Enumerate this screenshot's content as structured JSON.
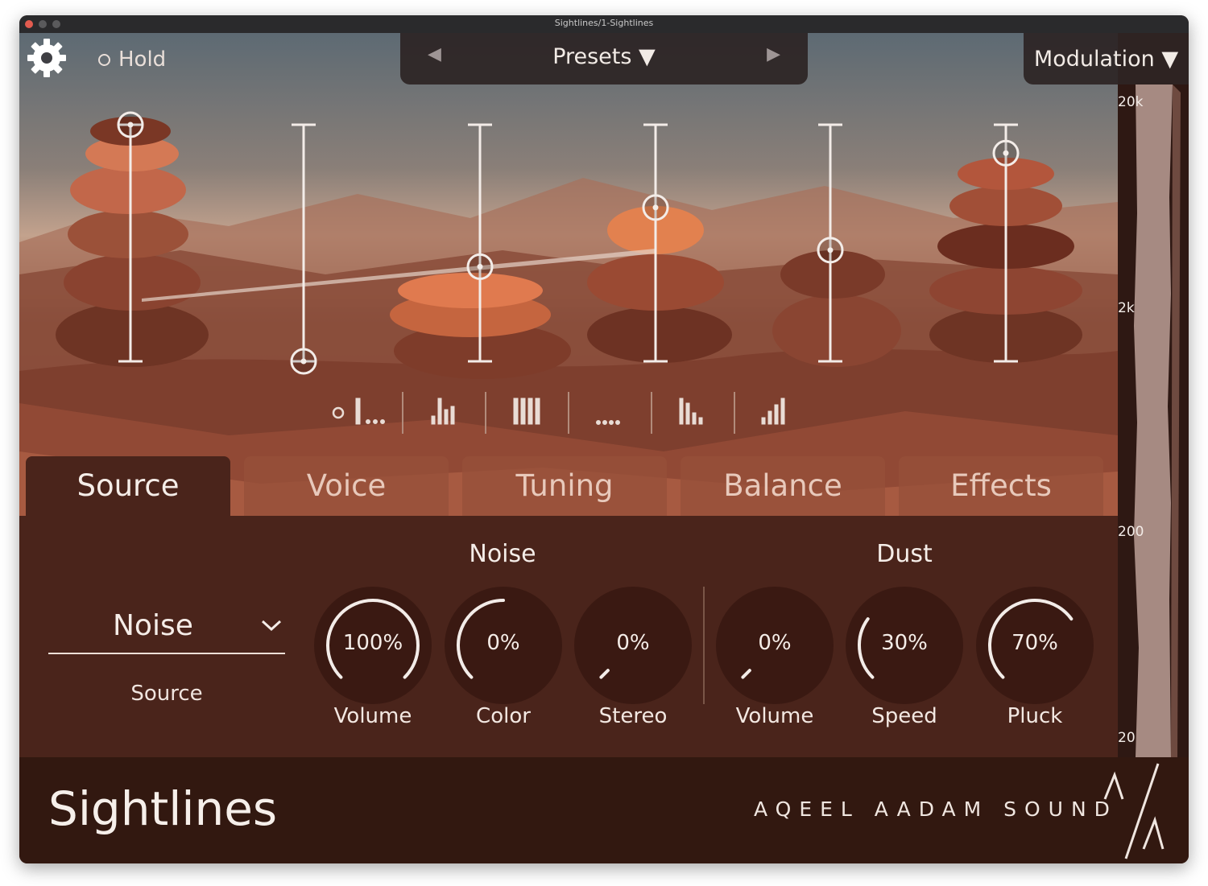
{
  "window": {
    "title": "Sightlines/1-Sightlines"
  },
  "header": {
    "hold_label": "Hold",
    "presets_label": "Presets ▼",
    "prev_arrow": "◀",
    "next_arrow": "▶",
    "modulation_label": "Modulation ▼"
  },
  "meter": {
    "labels": [
      "20k",
      "2k",
      "200",
      "20"
    ]
  },
  "sliders": [
    {
      "name": "slider-1",
      "level": 1.0
    },
    {
      "name": "slider-2",
      "level": 0.0
    },
    {
      "name": "slider-3",
      "level": 0.4
    },
    {
      "name": "slider-4",
      "level": 0.65
    },
    {
      "name": "slider-5",
      "level": 0.47
    },
    {
      "name": "slider-6",
      "level": 0.88
    }
  ],
  "tabs": [
    {
      "label": "Source",
      "active": true
    },
    {
      "label": "Voice",
      "active": false
    },
    {
      "label": "Tuning",
      "active": false
    },
    {
      "label": "Balance",
      "active": false
    },
    {
      "label": "Effects",
      "active": false
    }
  ],
  "panel": {
    "noise_section": "Noise",
    "dust_section": "Dust",
    "source_value": "Noise",
    "source_caption": "Source",
    "knobs": [
      {
        "value": "100%",
        "label": "Volume",
        "fraction": 1.0
      },
      {
        "value": "0%",
        "label": "Color",
        "fraction": 0.5
      },
      {
        "value": "0%",
        "label": "Stereo",
        "fraction": 0.0
      },
      {
        "value": "0%",
        "label": "Volume",
        "fraction": 0.0
      },
      {
        "value": "30%",
        "label": "Speed",
        "fraction": 0.3
      },
      {
        "value": "70%",
        "label": "Pluck",
        "fraction": 0.7
      }
    ]
  },
  "footer": {
    "app_name": "Sightlines",
    "brand": "AQEEL AADAM SOUND"
  },
  "colors": {
    "accent": "#f3ece8",
    "panel": "#4a241b",
    "footer": "#321810"
  }
}
